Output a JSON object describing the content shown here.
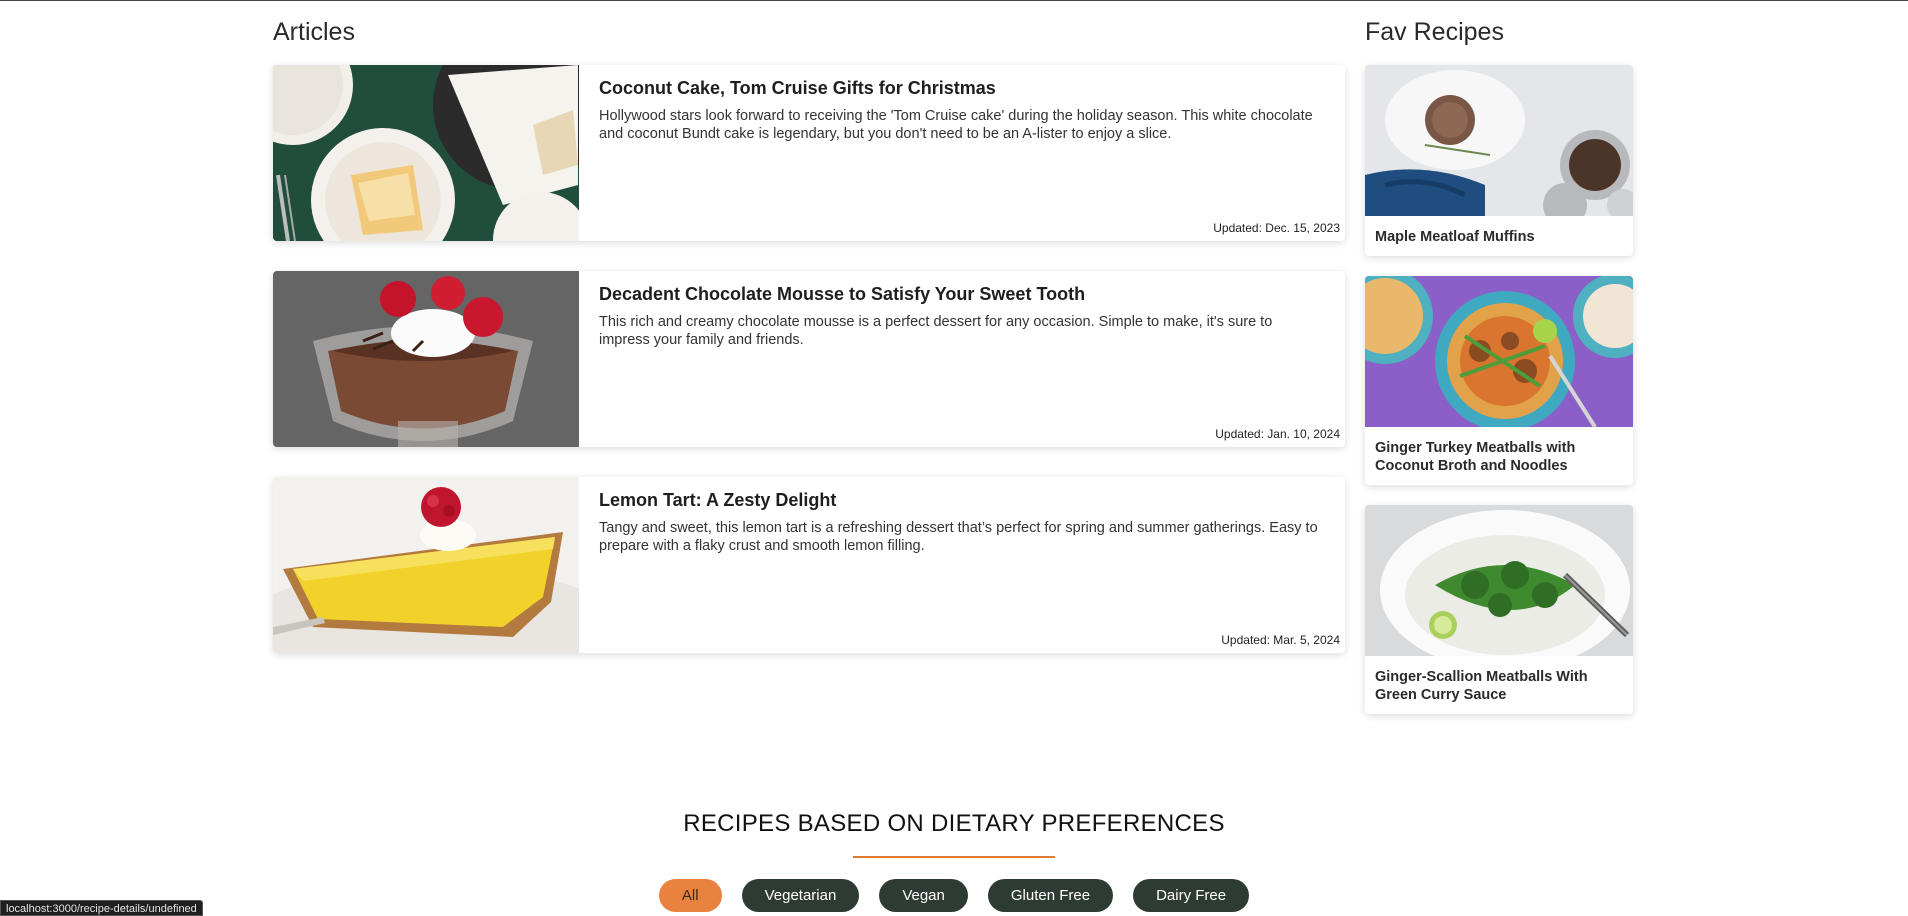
{
  "articles": {
    "title": "Articles",
    "items": [
      {
        "title": "Coconut Cake, Tom Cruise Gifts for Christmas",
        "description": "Hollywood stars look forward to receiving the 'Tom Cruise cake' during the holiday season. This white chocolate and coconut Bundt cake is legendary, but you don't need to be an A-lister to enjoy a slice.",
        "updated": "Updated: Dec. 15, 2023"
      },
      {
        "title": "Decadent Chocolate Mousse to Satisfy Your Sweet Tooth",
        "description": "This rich and creamy chocolate mousse is a perfect dessert for any occasion. Simple to make, it's sure to impress your family and friends.",
        "updated": "Updated: Jan. 10, 2024"
      },
      {
        "title": "Lemon Tart: A Zesty Delight",
        "description": "Tangy and sweet, this lemon tart is a refreshing dessert that’s perfect for spring and summer gatherings. Easy to prepare with a flaky crust and smooth lemon filling.",
        "updated": "Updated: Mar. 5, 2024"
      }
    ]
  },
  "fav": {
    "title": "Fav Recipes",
    "items": [
      {
        "name": "Maple Meatloaf Muffins"
      },
      {
        "name": "Ginger Turkey Meatballs with Coconut Broth and Noodles"
      },
      {
        "name": "Ginger-Scallion Meatballs With Green Curry Sauce"
      }
    ]
  },
  "dietary": {
    "title": "RECIPES BASED ON DIETARY PREFERENCES",
    "filters": [
      {
        "label": "All",
        "active": true
      },
      {
        "label": "Vegetarian",
        "active": false
      },
      {
        "label": "Vegan",
        "active": false
      },
      {
        "label": "Gluten Free",
        "active": false
      },
      {
        "label": "Dairy Free",
        "active": false
      }
    ]
  },
  "status_bar": {
    "url": "localhost:3000/recipe-details/undefined"
  },
  "colors": {
    "accent": "#e8823e",
    "pill": "#2e3b33"
  }
}
